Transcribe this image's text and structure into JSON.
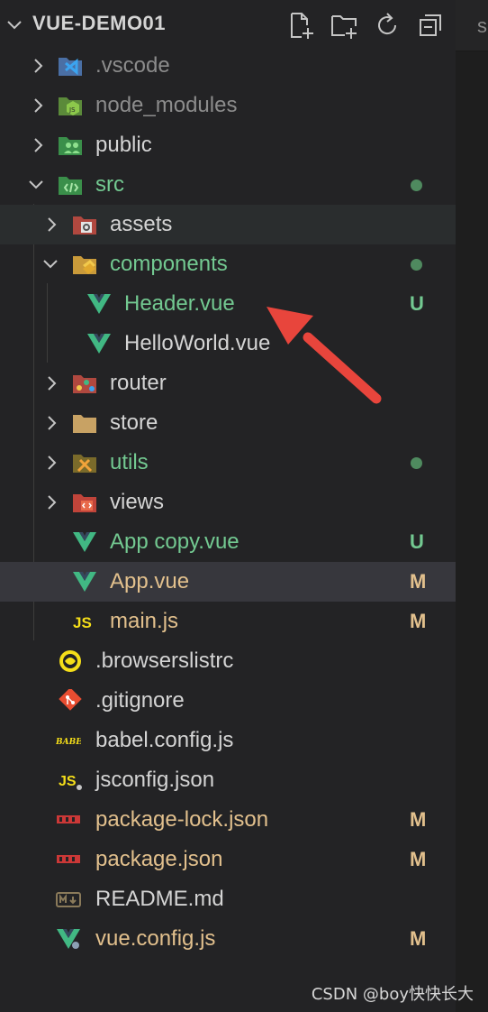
{
  "explorer": {
    "title": "VUE-DEMO01",
    "actions": [
      "new-file-icon",
      "new-folder-icon",
      "refresh-icon",
      "collapse-all-icon"
    ]
  },
  "tree": {
    "vscode": ".vscode",
    "node_modules": "node_modules",
    "public": "public",
    "src": "src",
    "assets": "assets",
    "components": "components",
    "header_vue": "Header.vue",
    "header_vue_badge": "U",
    "helloworld_vue": "HelloWorld.vue",
    "router": "router",
    "store": "store",
    "utils": "utils",
    "views": "views",
    "app_copy_vue": "App copy.vue",
    "app_copy_vue_badge": "U",
    "app_vue": "App.vue",
    "app_vue_badge": "M",
    "main_js": "main.js",
    "main_js_badge": "M",
    "browserslistrc": ".browserslistrc",
    "gitignore": ".gitignore",
    "babel_config": "babel.config.js",
    "jsconfig": "jsconfig.json",
    "package_lock": "package-lock.json",
    "package_lock_badge": "M",
    "package_json": "package.json",
    "package_json_badge": "M",
    "readme": "README.md",
    "vue_config": "vue.config.js",
    "vue_config_badge": "M"
  },
  "colors": {
    "untracked": "#73c991",
    "modified": "#e2c08d",
    "ignored": "#8c8c8c",
    "arrow": "#e8453c"
  },
  "watermark": "CSDN @boy快快长大",
  "editor_tab_char": "s"
}
